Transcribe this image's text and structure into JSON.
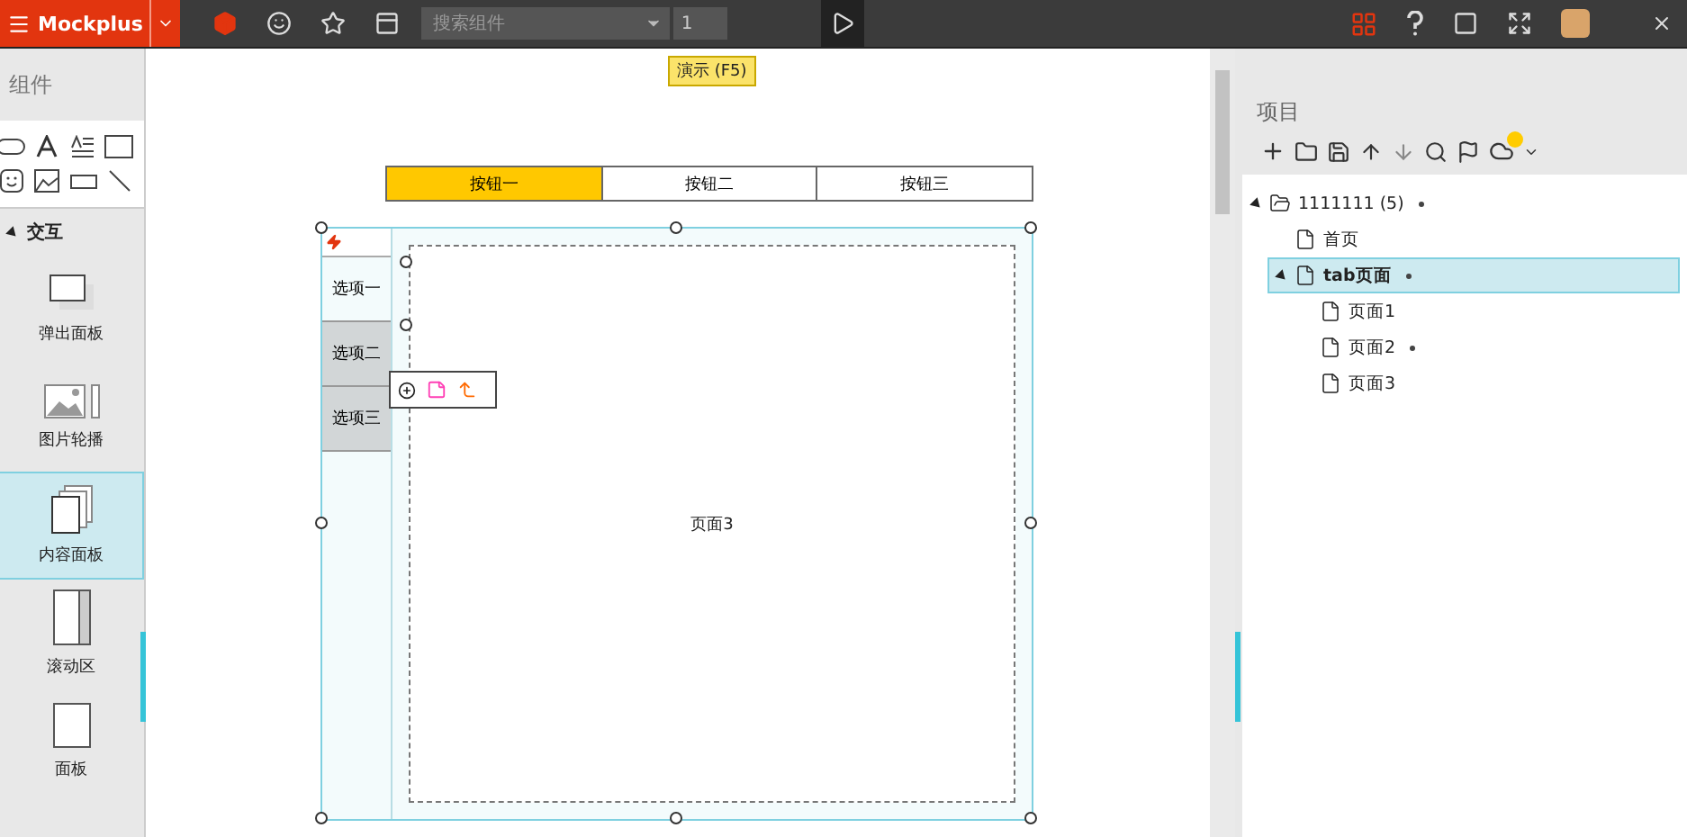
{
  "toolbar": {
    "brand": "Mockplus",
    "search": {
      "placeholder": "搜索组件"
    },
    "page_number": "1",
    "tooltip": "演示 (F5)"
  },
  "components_panel": {
    "title": "组件",
    "section": {
      "label": "交互",
      "expanded": true
    },
    "items": [
      {
        "label": "弹出面板",
        "kind": "popup",
        "selected": false
      },
      {
        "label": "图片轮播",
        "kind": "carousel",
        "selected": false
      },
      {
        "label": "内容面板",
        "kind": "content",
        "selected": true
      },
      {
        "label": "滚动区",
        "kind": "scroll",
        "selected": false
      },
      {
        "label": "面板",
        "kind": "panel",
        "selected": false
      }
    ]
  },
  "canvas": {
    "button_group": [
      {
        "label": "按钮一",
        "selected": true
      },
      {
        "label": "按钮二",
        "selected": false
      },
      {
        "label": "按钮三",
        "selected": false
      }
    ],
    "tabs": [
      {
        "label": "选项一",
        "selected": true
      },
      {
        "label": "选项二",
        "selected": false
      },
      {
        "label": "选项三",
        "selected": false
      }
    ],
    "content_label": "页面3"
  },
  "project_panel": {
    "title": "项目",
    "tree": [
      {
        "label": "1111111 (5)",
        "kind": "folder",
        "modified": true,
        "expanded": true,
        "selected": false,
        "children": [
          {
            "label": "首页",
            "kind": "page",
            "modified": false,
            "selected": false
          },
          {
            "label": "tab页面",
            "kind": "page",
            "modified": true,
            "expanded": true,
            "selected": true,
            "children": [
              {
                "label": "页面1",
                "kind": "page",
                "modified": false,
                "selected": false
              },
              {
                "label": "页面2",
                "kind": "page",
                "modified": true,
                "selected": false
              },
              {
                "label": "页面3",
                "kind": "page",
                "modified": false,
                "selected": false
              }
            ]
          }
        ]
      }
    ]
  }
}
